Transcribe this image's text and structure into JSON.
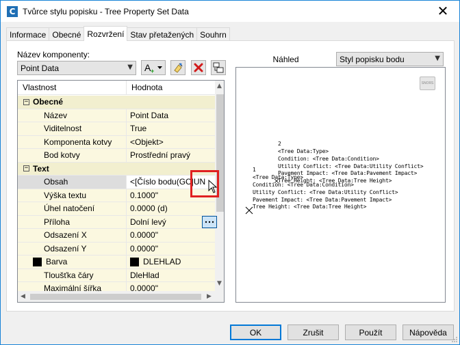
{
  "window": {
    "title": "Tvůrce stylu popisku - Tree Property Set Data",
    "app_icon": "C"
  },
  "tabs": [
    {
      "label": "Informace"
    },
    {
      "label": "Obecné"
    },
    {
      "label": "Rozvržení"
    },
    {
      "label": "Stav přetažených"
    },
    {
      "label": "Souhrn"
    }
  ],
  "left": {
    "component_label": "Název komponenty:",
    "component_value": "Point Data",
    "grid": {
      "col_property": "Vlastnost",
      "col_value": "Hodnota",
      "rows": [
        {
          "name": "Obecné",
          "group": true,
          "expander": "−"
        },
        {
          "name": "Název",
          "value": "Point Data"
        },
        {
          "name": "Viditelnost",
          "value": "True"
        },
        {
          "name": "Komponenta kotvy",
          "value": "<Objekt>"
        },
        {
          "name": "Bod kotvy",
          "value": "Prostřední pravý"
        },
        {
          "name": "Text",
          "group": true,
          "expander": "−"
        },
        {
          "name": "Obsah",
          "value": "<[Číslo bodu(GC|UN",
          "selected": true
        },
        {
          "name": "Výška textu",
          "value": "0.1000\""
        },
        {
          "name": "Úhel natočení",
          "value": "0.0000 (d)"
        },
        {
          "name": "Příloha",
          "value": "Dolní levý"
        },
        {
          "name": "Odsazení X",
          "value": "0.0000\""
        },
        {
          "name": "Odsazení Y",
          "value": "0.0000\""
        },
        {
          "name": "Barva",
          "value": "DLEHLAD",
          "swatch": true
        },
        {
          "name": "Tloušťka čáry",
          "value": "DleHlad"
        },
        {
          "name": "Maximální šířka",
          "value": "0.0000\""
        }
      ]
    }
  },
  "preview": {
    "label": "Náhled",
    "style_value": "Styl popisku bodu",
    "orientation_badge": "SNORS",
    "lines": [
      "2",
      "<Tree Data:Type>",
      "Condition: <Tree Data:Condition>",
      "Utility Conflict: <Tree Data:Utility Conflict>",
      "Pavement Impact: <Tree Data:Pavement Impact>",
      "<Tree Data:Type>",
      "Tree Height: <Tree Data:Tree Height>",
      "Condition: <Tree Data:Condition>",
      "Utility Conflict: <Tree Data:Utility Conflict>",
      "Pavement Impact: <Tree Data:Pavement Impact>",
      "Tree Height: <Tree Data:Tree Height>",
      "1"
    ]
  },
  "buttons": {
    "ok": "OK",
    "cancel": "Zrušit",
    "apply": "Použít",
    "help": "Nápověda"
  },
  "colors": {
    "accent": "#0078d7",
    "highlight": "#e02020",
    "grid_cell": "#fbf8e0"
  }
}
